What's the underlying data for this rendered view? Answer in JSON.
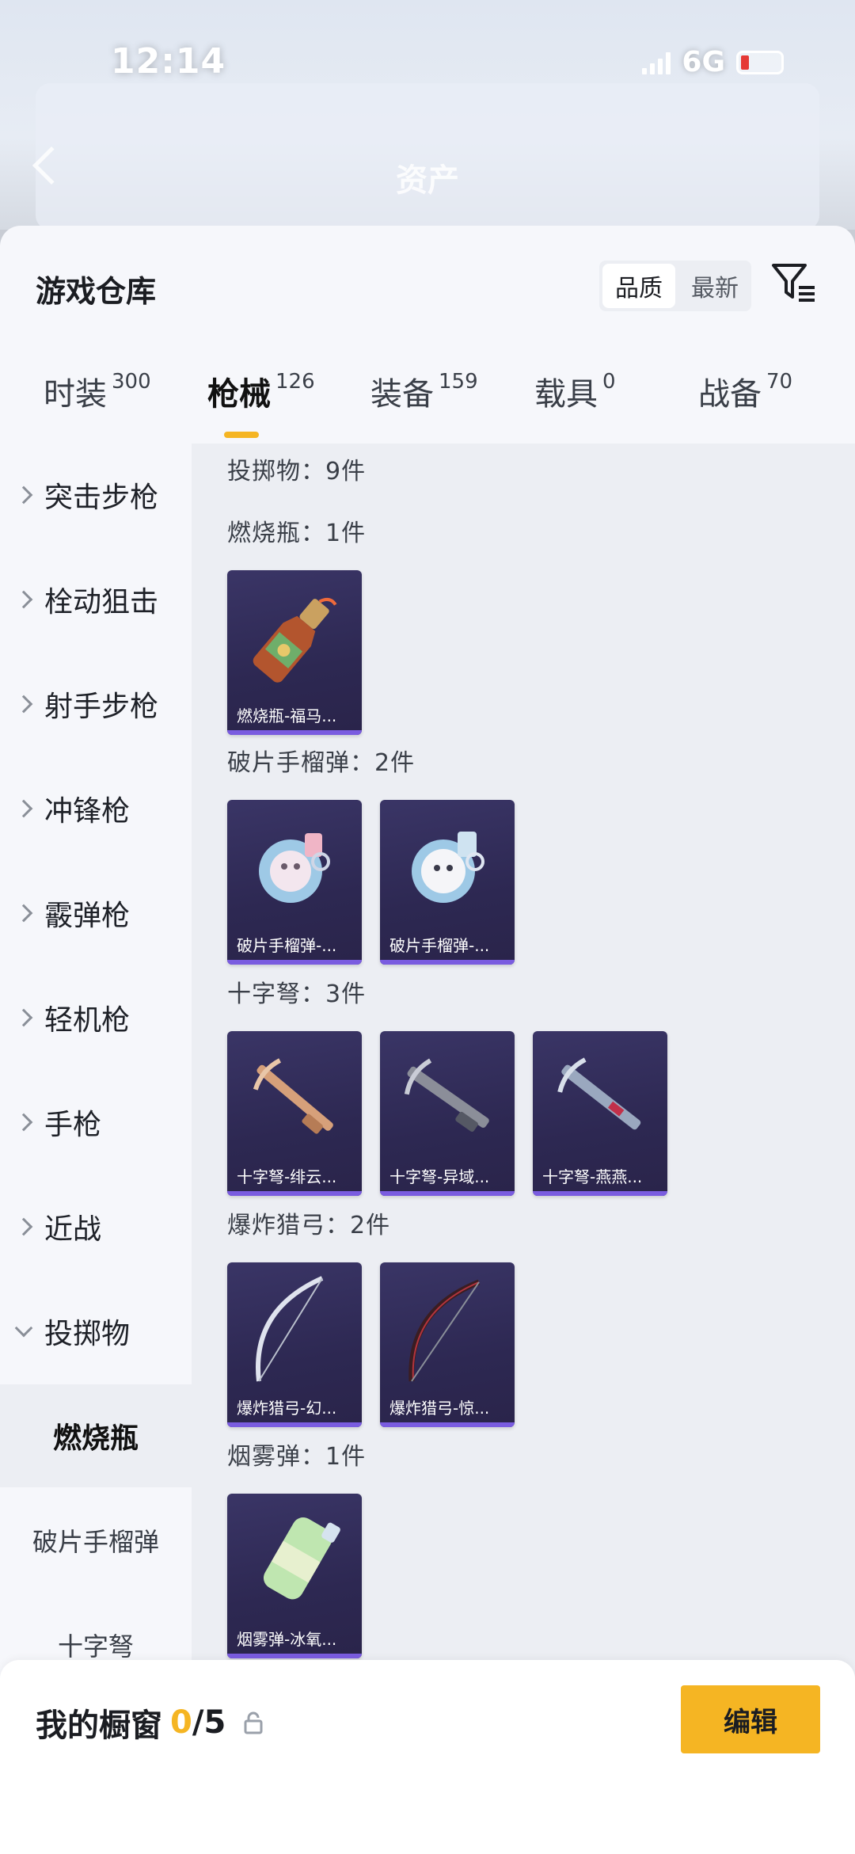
{
  "status_bar": {
    "time": "12:14",
    "network": "6G"
  },
  "header": {
    "title": "资产"
  },
  "sheet": {
    "title": "游戏仓库",
    "sort": {
      "options": [
        "品质",
        "最新"
      ],
      "selected": "品质"
    }
  },
  "tabs": [
    {
      "label": "时装",
      "count": "300"
    },
    {
      "label": "枪械",
      "count": "126",
      "active": true
    },
    {
      "label": "装备",
      "count": "159"
    },
    {
      "label": "载具",
      "count": "0"
    },
    {
      "label": "战备",
      "count": "70"
    }
  ],
  "sidebar": {
    "categories": [
      "突击步枪",
      "栓动狙击",
      "射手步枪",
      "冲锋枪",
      "霰弹枪",
      "轻机枪",
      "手枪",
      "近战",
      "投掷物"
    ],
    "subcategories": [
      "燃烧瓶",
      "破片手榴弹",
      "十字弩"
    ],
    "active_sub": "燃烧瓶"
  },
  "content": {
    "total_label": "投掷物：9件",
    "groups": [
      {
        "label": "燃烧瓶：1件",
        "items": [
          "燃烧瓶-福马..."
        ]
      },
      {
        "label": "破片手榴弹：2件",
        "items": [
          "破片手榴弹-...",
          "破片手榴弹-..."
        ]
      },
      {
        "label": "十字弩：3件",
        "items": [
          "十字弩-绯云...",
          "十字弩-异域...",
          "十字弩-燕燕..."
        ]
      },
      {
        "label": "爆炸猎弓：2件",
        "items": [
          "爆炸猎弓-幻...",
          "爆炸猎弓-惊..."
        ]
      },
      {
        "label": "烟雾弹：1件",
        "items": [
          "烟雾弹-冰氧..."
        ]
      }
    ]
  },
  "bottom_bar": {
    "title": "我的橱窗",
    "current": "0",
    "max": "/5",
    "edit_label": "编辑"
  },
  "colors": {
    "accent": "#f5b523",
    "card_bg": "#2d2852",
    "card_bar": "#7a5ce0"
  }
}
